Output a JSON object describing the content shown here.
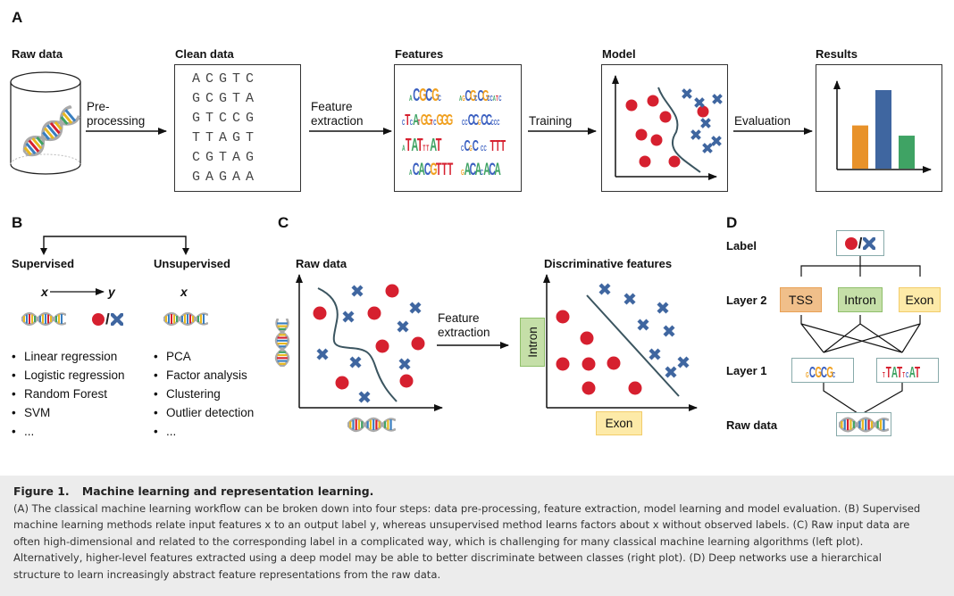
{
  "panels": {
    "A": {
      "letter": "A",
      "steps": [
        {
          "title": "Raw data"
        },
        {
          "title": "Clean data"
        },
        {
          "title": "Features"
        },
        {
          "title": "Model"
        },
        {
          "title": "Results"
        }
      ],
      "arrows": [
        {
          "line1": "Pre-",
          "line2": "processing"
        },
        {
          "line1": "Feature",
          "line2": "extraction"
        },
        {
          "line1": "Training",
          "line2": ""
        },
        {
          "line1": "Evaluation",
          "line2": ""
        }
      ],
      "clean_data_rows": [
        "ACGTC",
        "GCGTA",
        "GTCCG",
        "TTAGT",
        "CGTAG",
        "GAGAA"
      ],
      "feature_motifs": [
        "sCGCGc",
        "ssCGcCGccsss",
        "cTsAsGGscGGG",
        "scCCsCCccc",
        "sTATsxAT",
        "cCsC cc TTT",
        "sCACGTTT",
        "sACAsACA"
      ],
      "results_chart": {
        "type": "bar",
        "values": [
          0.55,
          1.0,
          0.42
        ],
        "colors": [
          "#e8922a",
          "#3f66a0",
          "#3fa364"
        ]
      }
    },
    "B": {
      "letter": "B",
      "supervised": {
        "title": "Supervised",
        "x": "x",
        "y": "y",
        "label_separator": "/",
        "items": [
          "Linear regression",
          "Logistic regression",
          "Random Forest",
          "SVM",
          "..."
        ]
      },
      "unsupervised": {
        "title": "Unsupervised",
        "x": "x",
        "items": [
          "PCA",
          "Factor analysis",
          "Clustering",
          "Outlier detection",
          "..."
        ]
      }
    },
    "C": {
      "letter": "C",
      "left_title": "Raw data",
      "arrow_line1": "Feature",
      "arrow_line2": "extraction",
      "right_title": "Discriminative features",
      "y_axis_label": "Intron",
      "x_axis_label": "Exon"
    },
    "D": {
      "letter": "D",
      "rows": [
        "Label",
        "Layer 2",
        "Layer 1",
        "Raw data"
      ],
      "label_separator": "/",
      "layer2": [
        {
          "label": "TSS",
          "bg": "#f0bf8a",
          "border": "#e8a055"
        },
        {
          "label": "Intron",
          "bg": "#c5dfa8",
          "border": "#8fbf6a"
        },
        {
          "label": "Exon",
          "bg": "#fdeaa8",
          "border": "#f2cc6a"
        }
      ]
    }
  },
  "colors": {
    "circle": "#d6202f",
    "cross": "#3f66a0",
    "boundary": "#3b5560"
  },
  "caption": {
    "figure_label": "Figure 1.",
    "title": "Machine learning and representation learning.",
    "lines": [
      "(A) The classical machine learning workflow can be broken down into four steps: data pre-processing, feature extraction, model learning and model evaluation. (B) Supervised",
      "machine learning methods relate input features x to an output label y, whereas unsupervised method learns factors about x without observed labels. (C) Raw input data are",
      "often high-dimensional and related to the corresponding label in a complicated way, which is challenging for many classical machine learning algorithms (left plot).",
      "Alternatively, higher-level features extracted using a deep model may be able to better discriminate between classes (right plot). (D) Deep networks use a hierarchical",
      "structure to learn increasingly abstract feature representations from the raw data."
    ]
  }
}
